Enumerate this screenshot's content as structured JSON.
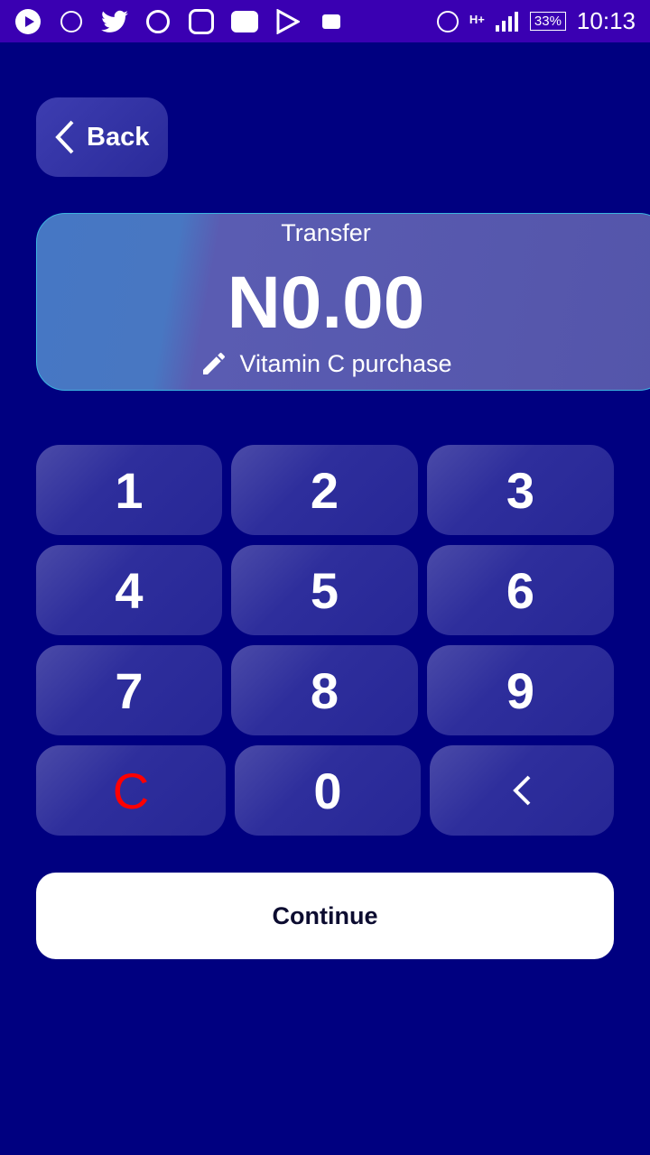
{
  "status_bar": {
    "battery": "33%",
    "time": "10:13",
    "network": "H+",
    "icons": [
      "play-icon",
      "alarm-icon",
      "twitter-icon",
      "whatsapp-icon",
      "instagram-icon",
      "youtube-icon",
      "play-store-icon",
      "message-icon"
    ]
  },
  "back_label": "Back",
  "card": {
    "title": "Transfer",
    "amount": "N0.00",
    "note": "Vitamin C purchase"
  },
  "keypad": {
    "keys": [
      "1",
      "2",
      "3",
      "4",
      "5",
      "6",
      "7",
      "8",
      "9"
    ],
    "clear": "C",
    "zero": "0",
    "clear_color": "#ff0000"
  },
  "continue_label": "Continue"
}
